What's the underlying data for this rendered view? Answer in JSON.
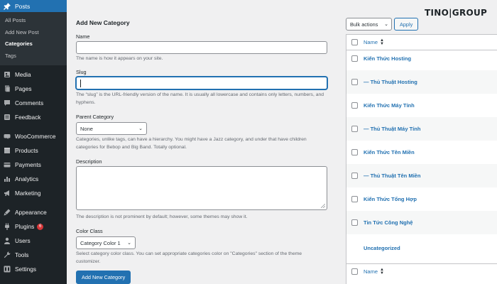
{
  "sidebar": {
    "posts_label": "Posts",
    "submenu": [
      "All Posts",
      "Add New Post",
      "Categories",
      "Tags"
    ],
    "items": [
      {
        "label": "Media",
        "icon": "media-icon"
      },
      {
        "label": "Pages",
        "icon": "pages-icon"
      },
      {
        "label": "Comments",
        "icon": "comments-icon"
      },
      {
        "label": "Feedback",
        "icon": "feedback-icon"
      },
      {
        "label": "WooCommerce",
        "icon": "woocommerce-icon"
      },
      {
        "label": "Products",
        "icon": "products-icon"
      },
      {
        "label": "Payments",
        "icon": "payments-icon"
      },
      {
        "label": "Analytics",
        "icon": "analytics-icon"
      },
      {
        "label": "Marketing",
        "icon": "marketing-icon"
      },
      {
        "label": "Appearance",
        "icon": "appearance-icon"
      },
      {
        "label": "Plugins",
        "icon": "plugins-icon",
        "badge": "6"
      },
      {
        "label": "Users",
        "icon": "users-icon"
      },
      {
        "label": "Tools",
        "icon": "tools-icon"
      },
      {
        "label": "Settings",
        "icon": "settings-icon"
      }
    ]
  },
  "form": {
    "heading": "Add New Category",
    "name_label": "Name",
    "name_help": "The name is how it appears on your site.",
    "slug_label": "Slug",
    "slug_help": "The “slug” is the URL-friendly version of the name. It is usually all lowercase and contains only letters, numbers, and hyphens.",
    "parent_label": "Parent Category",
    "parent_value": "None",
    "parent_help": "Categories, unlike tags, can have a hierarchy. You might have a Jazz category, and under that have children categories for Bebop and Big Band. Totally optional.",
    "description_label": "Description",
    "description_help": "The description is not prominent by default; however, some themes may show it.",
    "color_label": "Color Class",
    "color_value": "Category Color 1",
    "color_help": "Select category color class. You can set appropriate categories color on \"Categories\" section of the theme customizer.",
    "submit_label": "Add New Category"
  },
  "list": {
    "bulk_label": "Bulk actions",
    "apply_label": "Apply",
    "name_header": "Name",
    "rows": [
      "Kiến Thức Hosting",
      "— Thủ Thuật Hosting",
      "Kiến Thức Máy Tính",
      "— Thủ Thuật Máy Tính",
      "Kiến Thức Tên Miền",
      "— Thủ Thuật Tên Miền",
      "Kiến Thức Tổng Hợp",
      "Tin Tức Công Nghệ",
      "Uncategorized"
    ],
    "footer_header": "Name"
  },
  "logo": {
    "part1": "TINO",
    "part2": "GROUP"
  },
  "colors": {
    "accent": "#2271b1",
    "sidebar": "#1d2327",
    "badge": "#d63638"
  }
}
